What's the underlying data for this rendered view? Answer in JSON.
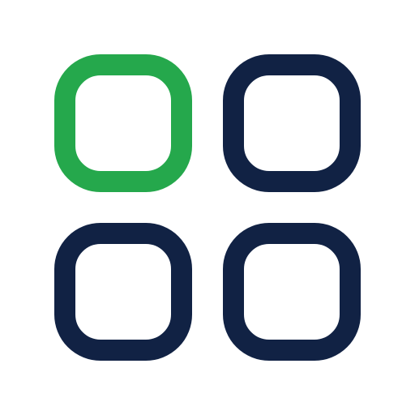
{
  "icon": {
    "name": "app-grid-icon",
    "tiles": [
      {
        "name": "top-left-tile",
        "color": "#25A84C"
      },
      {
        "name": "top-right-tile",
        "color": "#112244"
      },
      {
        "name": "bottom-left-tile",
        "color": "#112244"
      },
      {
        "name": "bottom-right-tile",
        "color": "#112244"
      }
    ]
  }
}
